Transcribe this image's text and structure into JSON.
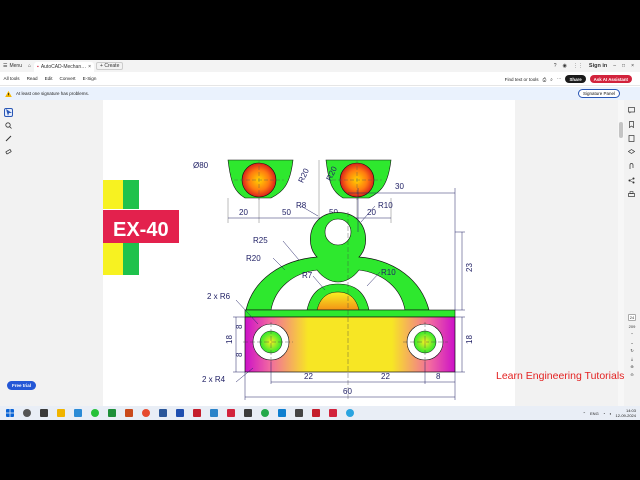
{
  "browser": {
    "menu_label": "Menu",
    "tab_title": "AutoCAD-Mechanical-E...",
    "new_tab_label": "+ Create",
    "sign_in": "Sign in"
  },
  "toolbar": {
    "items": [
      "All tools",
      "Read",
      "Edit",
      "Convert",
      "E-Sign"
    ],
    "find_label": "Find text or tools",
    "share_label": "Share",
    "ai_label": "Ask AI Assistant"
  },
  "signature_bar": {
    "message": "At least one signature has problems.",
    "panel_button": "Signature Panel"
  },
  "drawing": {
    "exercise_label": "EX-40",
    "top_dims": [
      "Ø80",
      "R20",
      "R20",
      "20",
      "50",
      "50",
      "20"
    ],
    "dim_30": "30",
    "dim_r8": "R8",
    "dim_r10_top": "R10",
    "dim_r25": "R25",
    "dim_r20": "R20",
    "dim_r7": "R7",
    "dim_r10_mid": "R10",
    "dim_23": "23",
    "dim_2xr6": "2 x R6",
    "dim_8a": "8",
    "dim_18_left": "18",
    "dim_8b": "8",
    "dim_18_right": "18",
    "dim_2xr4": "2 x R4",
    "dim_22a": "22",
    "dim_22b": "22",
    "dim_8c": "8",
    "dim_60": "60"
  },
  "watermark": "Learn Engineering Tutorials",
  "free_trial": "Free trial",
  "page_nav": {
    "current": "24",
    "total": "209"
  },
  "taskbar": {
    "lang": "ENG",
    "time": "14:03",
    "date": "12-09-2024"
  },
  "colors": {
    "green": "#2ee82e",
    "magenta": "#cc10c8",
    "yellow": "#f7f221",
    "orange": "#f39216",
    "ex_red": "#e3214d",
    "dim_blue": "#222266"
  }
}
